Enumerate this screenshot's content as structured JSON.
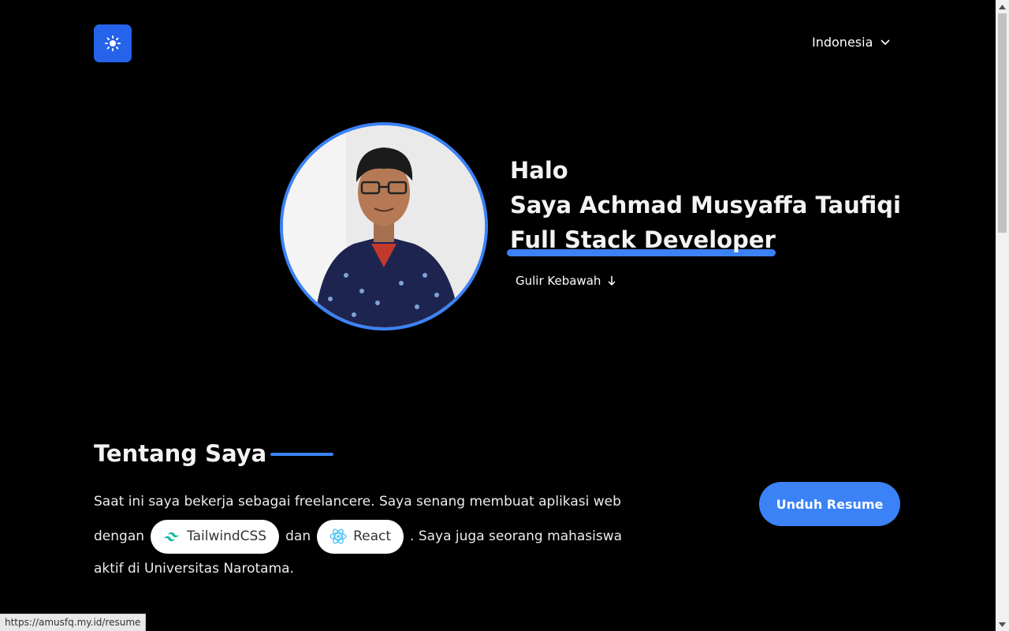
{
  "header": {
    "theme_toggle_icon": "sun-icon",
    "language_selected": "Indonesia"
  },
  "hero": {
    "greeting": "Halo",
    "name_line": "Saya Achmad Musyaffa Taufiqi",
    "role": "Full Stack Developer",
    "scroll_hint": "Gulir Kebawah"
  },
  "about": {
    "title": "Tentang Saya",
    "text_part1": "Saat ini saya bekerja sebagai freelancere. Saya senang membuat aplikasi web",
    "text_dengan": "dengan",
    "pill_tailwind": "TailwindCSS",
    "text_dan": "dan",
    "pill_react": "React",
    "text_part2": ". Saya juga seorang mahasiswa",
    "text_part3": "aktif di Universitas Narotama.",
    "resume_button": "Unduh Resume"
  },
  "status_bar": {
    "url": "https://amusfq.my.id/resume"
  },
  "colors": {
    "accent": "#3b82f6",
    "theme_button": "#2563eb",
    "background": "#000000"
  }
}
